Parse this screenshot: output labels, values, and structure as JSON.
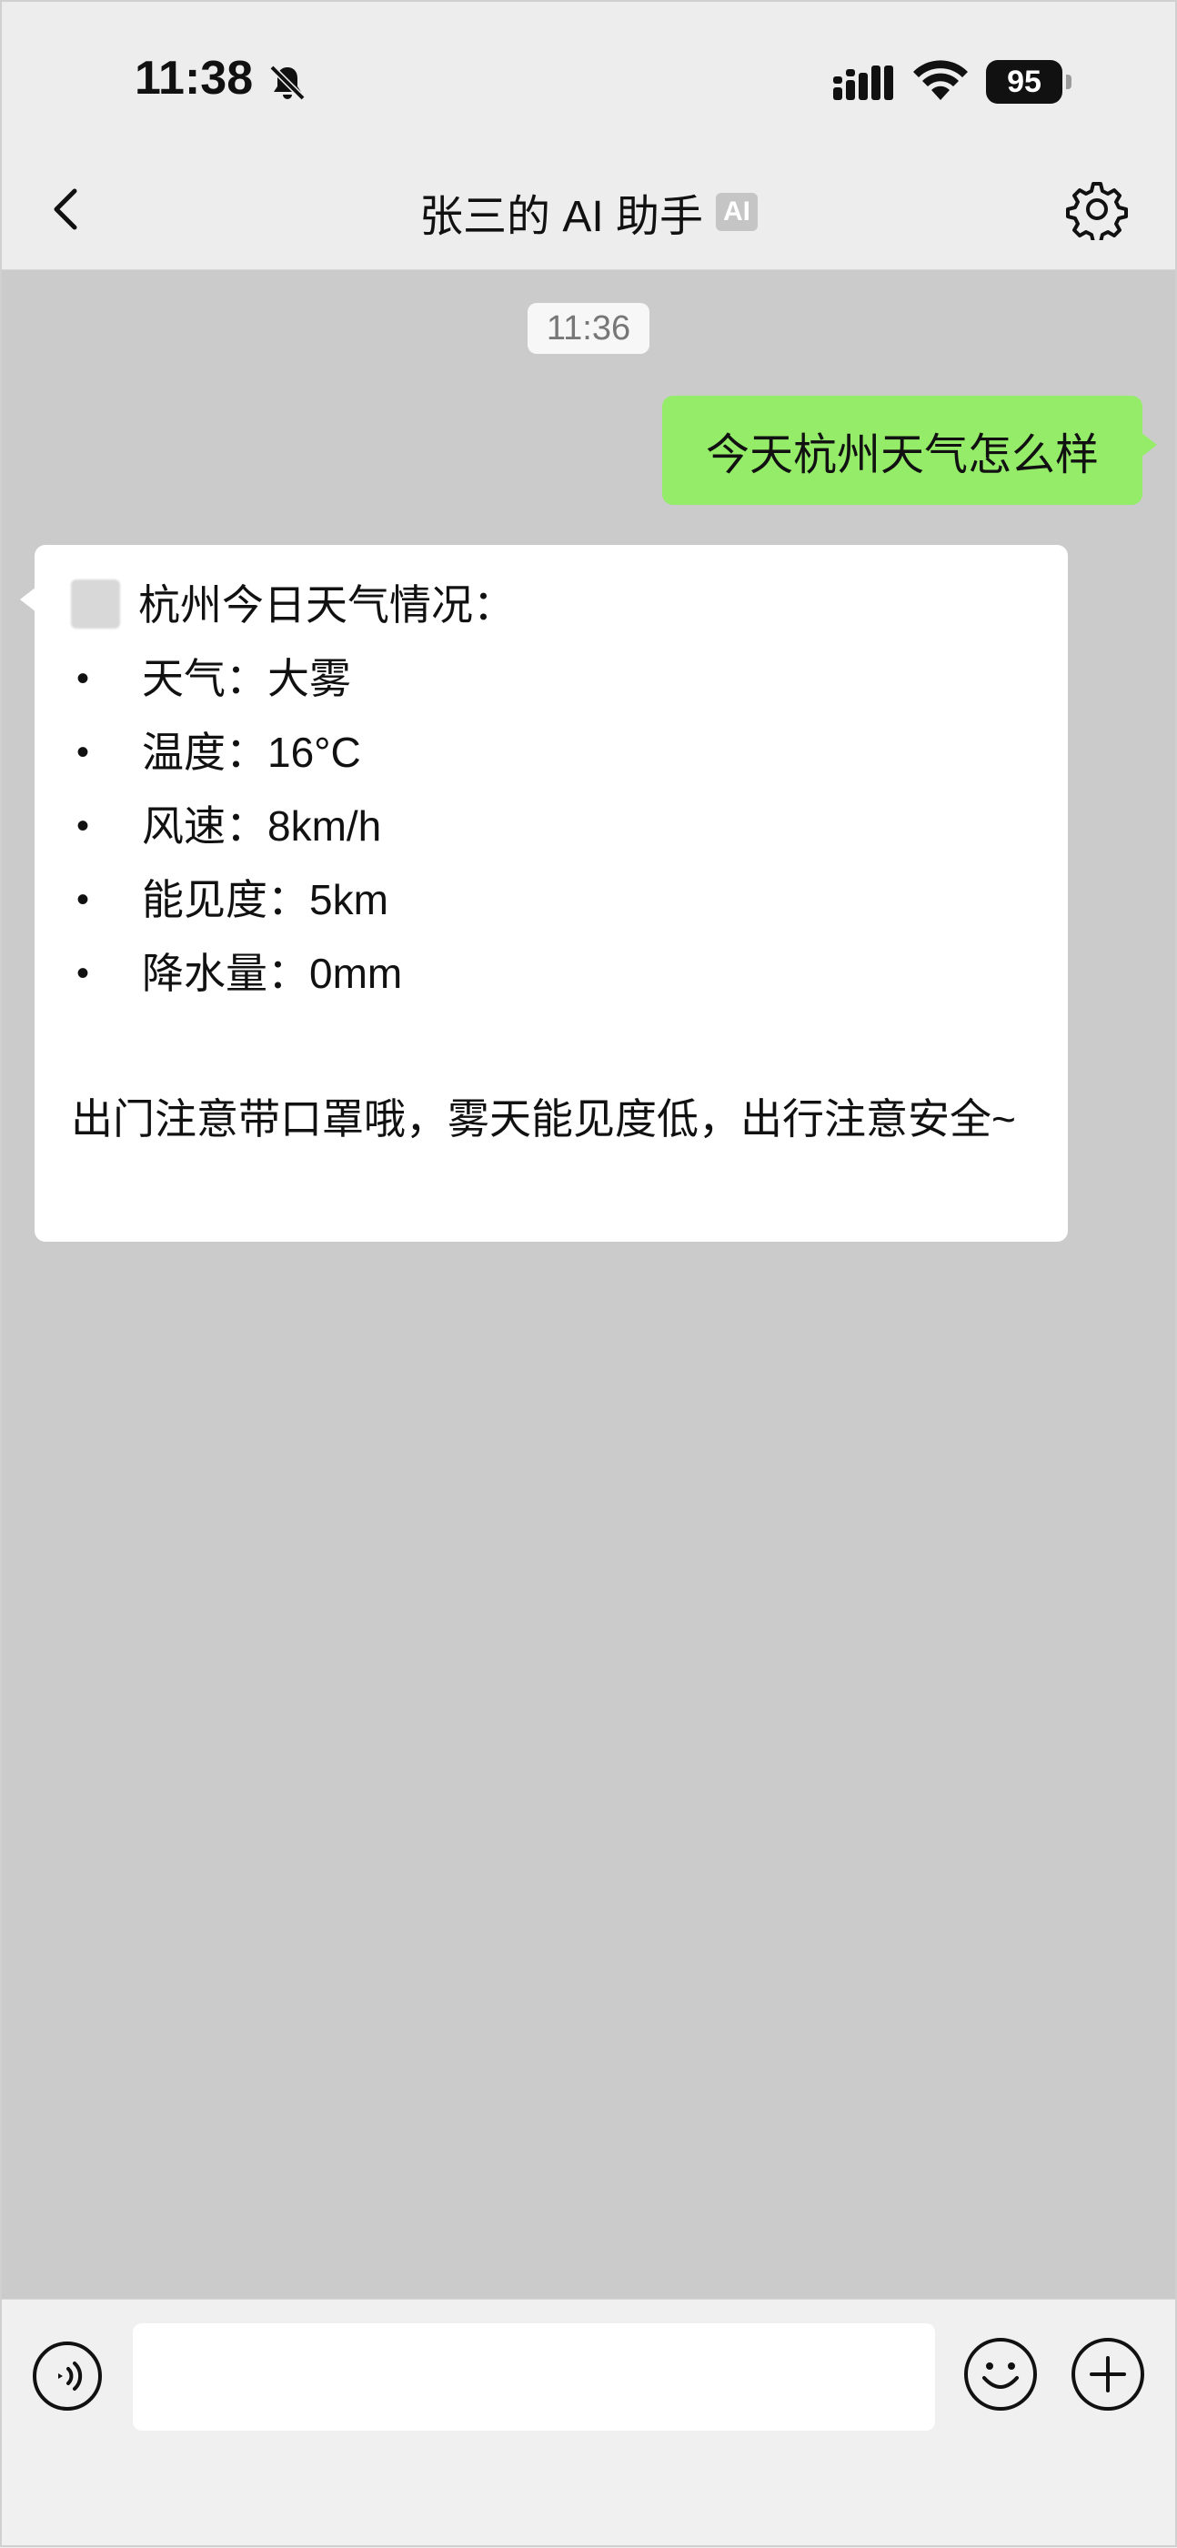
{
  "status_bar": {
    "time": "11:38",
    "battery": "95",
    "icons": [
      "bell-muted-icon",
      "signal-icon",
      "wifi-icon",
      "battery-icon"
    ]
  },
  "nav": {
    "title": "张三的 AI 助手",
    "badge": "AI",
    "icons": [
      "back-arrow-icon",
      "settings-gear-icon"
    ]
  },
  "chat": {
    "timestamp": "11:36",
    "outgoing_message": "今天杭州天气怎么样",
    "incoming": {
      "heading": "杭州今日天气情况：",
      "items": [
        {
          "label": "天气：",
          "value": "大雾"
        },
        {
          "label": "温度：",
          "value": "16°C"
        },
        {
          "label": "风速：",
          "value": "8km/h"
        },
        {
          "label": "能见度：",
          "value": "5km"
        },
        {
          "label": "降水量：",
          "value": "0mm"
        }
      ],
      "footer": "出门注意带口罩哦，雾天能见度低，出行注意安全~"
    }
  },
  "input_bar": {
    "value": "",
    "icons": [
      "voice-icon",
      "mic-icon",
      "emoji-icon",
      "plus-icon"
    ]
  },
  "colors": {
    "outgoing_bubble": "#95ec69",
    "incoming_bubble": "#ffffff",
    "chat_background": "#cbcbcb",
    "bar_background": "#ededed"
  }
}
